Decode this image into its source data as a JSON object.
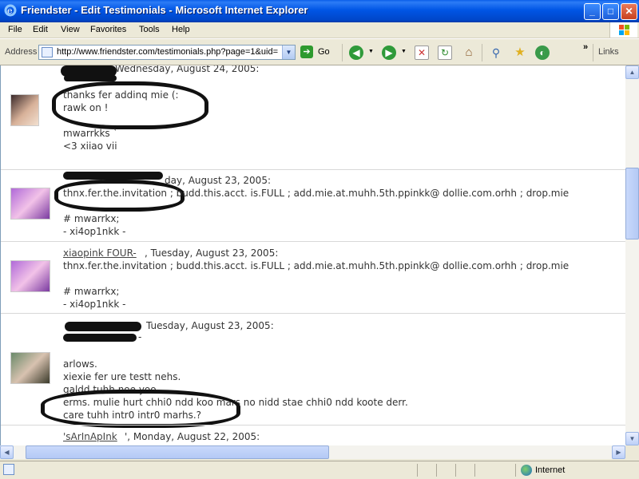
{
  "window": {
    "title": "Friendster - Edit Testimonials - Microsoft Internet Explorer",
    "buttons": {
      "minimize": "_",
      "maximize": "□",
      "close": "✕"
    }
  },
  "menu": [
    "File",
    "Edit",
    "View",
    "Favorites",
    "Tools",
    "Help"
  ],
  "address": {
    "label": "Address",
    "url": "http://www.friendster.com/testimonials.php?page=1&uid=",
    "go_label": "Go",
    "links_label": "Links"
  },
  "entries": [
    {
      "date": "Wednesday, August 24, 2005:",
      "lines": [
        "thanks fer addinq mie (:",
        "rawk on !",
        "",
        "mwarrkks `",
        "<3 xiiao vii"
      ]
    },
    {
      "date": "day, August 23, 2005:",
      "lines": [
        "thnx.fer.the.invitation ; budd.this.acct. is.FULL ; add.mie.at.muhh.5th.ppinkk@ dollie.com.orhh ; drop.mie",
        "# mwarrkx;",
        "- xi4op1nkk -"
      ]
    },
    {
      "author": "xiaopink FOUR-",
      "date": ", Tuesday, August 23, 2005:",
      "lines": [
        "thnx.fer.the.invitation ; budd.this.acct. is.FULL ; add.mie.at.muhh.5th.ppinkk@ dollie.com.orhh ; drop.mie",
        "",
        "# mwarrkx;",
        "- xi4op1nkk -"
      ]
    },
    {
      "date": "Tuesday, August 23, 2005:",
      "lines": [
        "-",
        "",
        "arlows.",
        "xiexie fer ure testt nehs.",
        "galdd tuhh noe yoo.",
        "erms. mulie hurt chhi0 ndd koo  mars no nidd stae chhi0 ndd koote derr.",
        "care tuhh intr0 intr0 marhs.?"
      ]
    },
    {
      "author": "'sArInApInk",
      "date": "', Monday, August 22, 2005:"
    }
  ],
  "status": {
    "zone": "Internet"
  }
}
